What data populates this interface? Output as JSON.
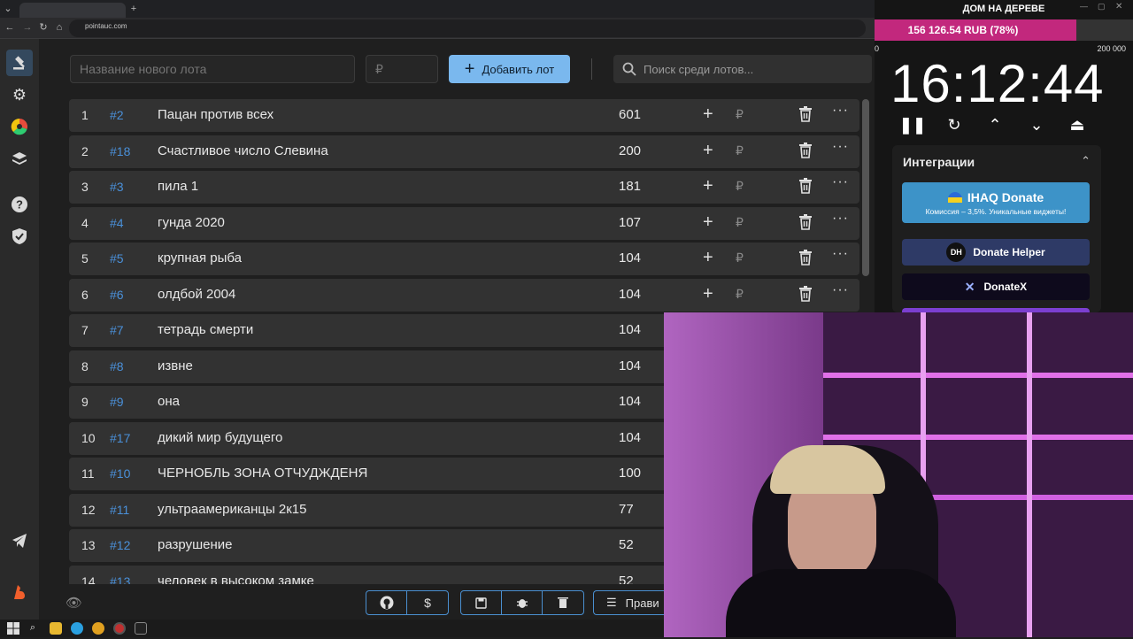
{
  "browser": {
    "url": "pointauc.com"
  },
  "sidebar": {
    "items": [
      {
        "icon": "gavel-icon"
      },
      {
        "icon": "gear-icon"
      },
      {
        "icon": "wheel-icon"
      },
      {
        "icon": "layers-icon"
      },
      {
        "icon": "help-icon"
      },
      {
        "icon": "shield-icon"
      },
      {
        "icon": "telegram-icon"
      },
      {
        "icon": "boosty-icon"
      }
    ]
  },
  "toolbar": {
    "lot_name_placeholder": "Название нового лота",
    "amount_placeholder": "₽",
    "add_label": "Добавить лот",
    "search_placeholder": "Поиск среди лотов..."
  },
  "lots": [
    {
      "num": "1",
      "id": "#2",
      "name": "Пацан против всех",
      "amount": "601"
    },
    {
      "num": "2",
      "id": "#18",
      "name": "Счастливое число Слевина",
      "amount": "200"
    },
    {
      "num": "3",
      "id": "#3",
      "name": "пила 1",
      "amount": "181"
    },
    {
      "num": "4",
      "id": "#4",
      "name": "гунда 2020",
      "amount": "107"
    },
    {
      "num": "5",
      "id": "#5",
      "name": "крупная рыба",
      "amount": "104"
    },
    {
      "num": "6",
      "id": "#6",
      "name": "олдбой 2004",
      "amount": "104"
    },
    {
      "num": "7",
      "id": "#7",
      "name": "тетрадь смерти",
      "amount": "104"
    },
    {
      "num": "8",
      "id": "#8",
      "name": "извне",
      "amount": "104"
    },
    {
      "num": "9",
      "id": "#9",
      "name": "она",
      "amount": "104"
    },
    {
      "num": "10",
      "id": "#17",
      "name": "дикий мир будущего",
      "amount": "104"
    },
    {
      "num": "11",
      "id": "#10",
      "name": "ЧЕРНОБЛЬ ЗОНА ОТЧУДЖДЕНЯ",
      "amount": "100"
    },
    {
      "num": "12",
      "id": "#11",
      "name": "ультраамериканцы 2к15",
      "amount": "77"
    },
    {
      "num": "13",
      "id": "#12",
      "name": "разрушение",
      "amount": "52"
    },
    {
      "num": "14",
      "id": "#13",
      "name": "человек в высоком замке",
      "amount": "52"
    }
  ],
  "row_actions": {
    "plus": "+",
    "currency": "₽",
    "more": "···"
  },
  "bottombar": {
    "rules_label": "Прави"
  },
  "overlay": {
    "title": "ДОМ НА ДЕРЕВЕ",
    "progress_text": "156 126.54 RUB (78%)",
    "progress_percent": 78,
    "scale_min": "0",
    "scale_max": "200 000",
    "timer": "16:12:44",
    "integrations_title": "Интеграции",
    "ihaq_label": "IHAQ Donate",
    "ihaq_sub": "Комиссия – 3,5%. Уникальные виджеты!",
    "donate_helper_label": "Donate Helper",
    "donatex_label": "DonateX"
  },
  "colors": {
    "accent": "#7ab8ee",
    "lot_id": "#4a90d9",
    "progress": "#c2287d"
  }
}
